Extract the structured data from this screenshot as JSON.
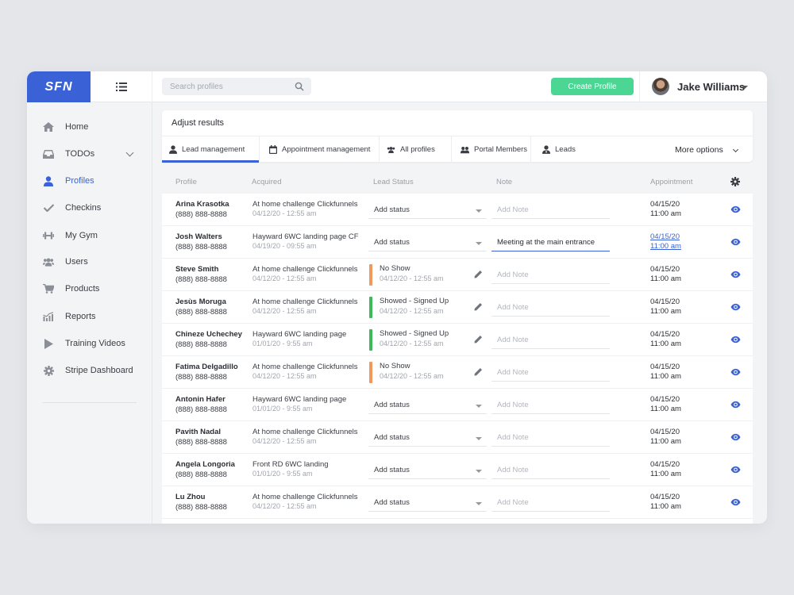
{
  "brand": {
    "logo_text": "SFN",
    "accent": "#3a62d6",
    "create_color": "#4cd693"
  },
  "topbar": {
    "search_placeholder": "Search profiles",
    "create_label": "Create Profile",
    "user_name": "Jake Williams"
  },
  "sidebar": {
    "items": [
      {
        "label": "Home",
        "icon": "home-icon"
      },
      {
        "label": "TODOs",
        "icon": "inbox-icon"
      },
      {
        "label": "Profiles",
        "icon": "person-icon"
      },
      {
        "label": "Checkins",
        "icon": "check-icon"
      },
      {
        "label": "My Gym",
        "icon": "dumbbell-icon"
      },
      {
        "label": "Users",
        "icon": "users-icon"
      },
      {
        "label": "Products",
        "icon": "cart-icon"
      },
      {
        "label": "Reports",
        "icon": "chart-icon"
      },
      {
        "label": "Training Videos",
        "icon": "play-icon"
      },
      {
        "label": "Stripe Dashboard",
        "icon": "gear-icon"
      }
    ]
  },
  "filters": {
    "title": "Adjust results",
    "tabs": [
      "Lead management",
      "Appointment management",
      "All profiles",
      "Portal Members",
      "Leads"
    ],
    "more": "More options"
  },
  "table": {
    "headers": {
      "profile": "Profile",
      "acquired": "Acquired",
      "lead_status": "Lead Status",
      "note": "Note",
      "appointment": "Appointment"
    },
    "status_colors": {
      "orange": "#f0995e",
      "green": "#3cb95a"
    },
    "rows": [
      {
        "name": "Arina Krasotka",
        "phone": "(888) 888-8888",
        "source": "At home challenge Clickfunnels",
        "acquired": "04/12/20 - 12:55 am",
        "status": "Add status",
        "note_placeholder": "Add Note",
        "note": "",
        "appt_date": "04/15/20",
        "appt_time": "11:00 am"
      },
      {
        "name": "Josh Walters",
        "phone": "(888) 888-8888",
        "source": "Hayward 6WC landing page CF",
        "acquired": "04/19/20 - 09:55 am",
        "status": "Add status",
        "note_placeholder": "Add Note",
        "note": "Meeting at the main entrance",
        "appt_date": "04/15/20",
        "appt_time": "11:00 am"
      },
      {
        "name": "Steve Smith",
        "phone": "(888) 888-8888",
        "source": "At home challenge Clickfunnels",
        "acquired": "04/12/20 - 12:55 am",
        "status": "No Show",
        "status_date": "04/12/20 - 12:55 am",
        "status_color": "#f0995e",
        "note_placeholder": "Add Note",
        "note": "",
        "appt_date": "04/15/20",
        "appt_time": "11:00 am"
      },
      {
        "name": "Jesùs Moruga",
        "phone": "(888) 888-8888",
        "source": "At home challenge Clickfunnels",
        "acquired": "04/12/20 - 12:55 am",
        "status": "Showed - Signed Up",
        "status_date": "04/12/20 - 12:55 am",
        "status_color": "#3cb95a",
        "note_placeholder": "Add Note",
        "note": "",
        "appt_date": "04/15/20",
        "appt_time": "11:00 am"
      },
      {
        "name": "Chineze Uchechey",
        "phone": "(888) 888-8888",
        "source": "Hayward 6WC landing page",
        "acquired": "01/01/20 - 9:55 am",
        "status": "Showed - Signed Up",
        "status_date": "04/12/20 - 12:55 am",
        "status_color": "#3cb95a",
        "note_placeholder": "Add Note",
        "note": "",
        "appt_date": "04/15/20",
        "appt_time": "11:00 am"
      },
      {
        "name": "Fatima Delgadillo",
        "phone": "(888) 888-8888",
        "source": "At home challenge Clickfunnels",
        "acquired": "04/12/20 - 12:55 am",
        "status": "No Show",
        "status_date": "04/12/20 - 12:55 am",
        "status_color": "#f0995e",
        "note_placeholder": "Add Note",
        "note": "",
        "appt_date": "04/15/20",
        "appt_time": "11:00 am"
      },
      {
        "name": "Antonin Hafer",
        "phone": "(888) 888-8888",
        "source": "Hayward 6WC landing page",
        "acquired": "01/01/20 - 9:55 am",
        "status": "Add status",
        "note_placeholder": "Add Note",
        "note": "",
        "appt_date": "04/15/20",
        "appt_time": "11:00 am"
      },
      {
        "name": "Pavith Nadal",
        "phone": "(888) 888-8888",
        "source": "At home challenge Clickfunnels",
        "acquired": "04/12/20 - 12:55 am",
        "status": "Add status",
        "note_placeholder": "Add Note",
        "note": "",
        "appt_date": "04/15/20",
        "appt_time": "11:00 am"
      },
      {
        "name": "Angela Longoria",
        "phone": "(888) 888-8888",
        "source": "Front RD 6WC landing",
        "acquired": "01/01/20 - 9:55 am",
        "status": "Add status",
        "note_placeholder": "Add Note",
        "note": "",
        "appt_date": "04/15/20",
        "appt_time": "11:00 am"
      },
      {
        "name": "Lu Zhou",
        "phone": "(888) 888-8888",
        "source": "At home challenge Clickfunnels",
        "acquired": "04/12/20 - 12:55 am",
        "status": "Add status",
        "note_placeholder": "Add Note",
        "note": "",
        "appt_date": "04/15/20",
        "appt_time": "11:00 am"
      }
    ]
  }
}
